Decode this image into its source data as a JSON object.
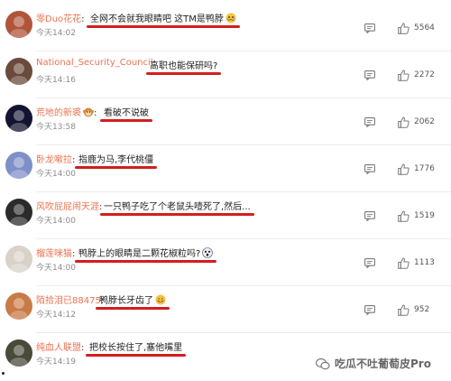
{
  "comments": [
    {
      "user": "零Duo花花",
      "text": "全网不会就我眼睛吧 这TM是鸭脖",
      "time": "今天14:02",
      "likes": "5564",
      "emoji": "cry",
      "avatar_color": "#b0553a"
    },
    {
      "user": "National_Security_Council",
      "text": "高职也能保研吗?",
      "time": "今天14:16",
      "likes": "2272",
      "emoji": "",
      "avatar_color": "#6a4a3a"
    },
    {
      "user": "荒地的新裘",
      "text": "看破不说破",
      "time": "今天13:58",
      "likes": "2062",
      "emoji": "",
      "avatar_color": "#141432",
      "name_emoji": "monkey"
    },
    {
      "user": "卧龙嗽拉",
      "text": "指鹿为马,李代桃僵",
      "time": "今天14:00",
      "likes": "1776",
      "emoji": "",
      "avatar_color": "#7f8fc8"
    },
    {
      "user": "风吹屁屁闹天涯",
      "text": "一只鸭子吃了个老鼠头噎死了,然后...",
      "time": "今天14:00",
      "likes": "1519",
      "emoji": "",
      "avatar_color": "#2b2b2b"
    },
    {
      "user": "榴莲咪猫",
      "text": "鸭脖上的眼睛是二颗花椒粒吗?",
      "time": "今天14:00",
      "likes": "1113",
      "emoji": "shock",
      "avatar_color": "#d9d2c8"
    },
    {
      "user": "陌拾泪已88475",
      "text": "鸭脖长牙齿了",
      "time": "今天14:12",
      "likes": "952",
      "emoji": "grin",
      "avatar_color": "#c97a45"
    },
    {
      "user": "纯血人联盟",
      "text": "把校长按住了,塞他嘴里",
      "time": "今天14:19",
      "likes": "",
      "emoji": "",
      "avatar_color": "#4a4a3a"
    }
  ],
  "watermark": "吃瓜不吐葡萄皮Pro",
  "icons": {
    "reply": "comment-icon",
    "like": "thumb-up-icon"
  }
}
